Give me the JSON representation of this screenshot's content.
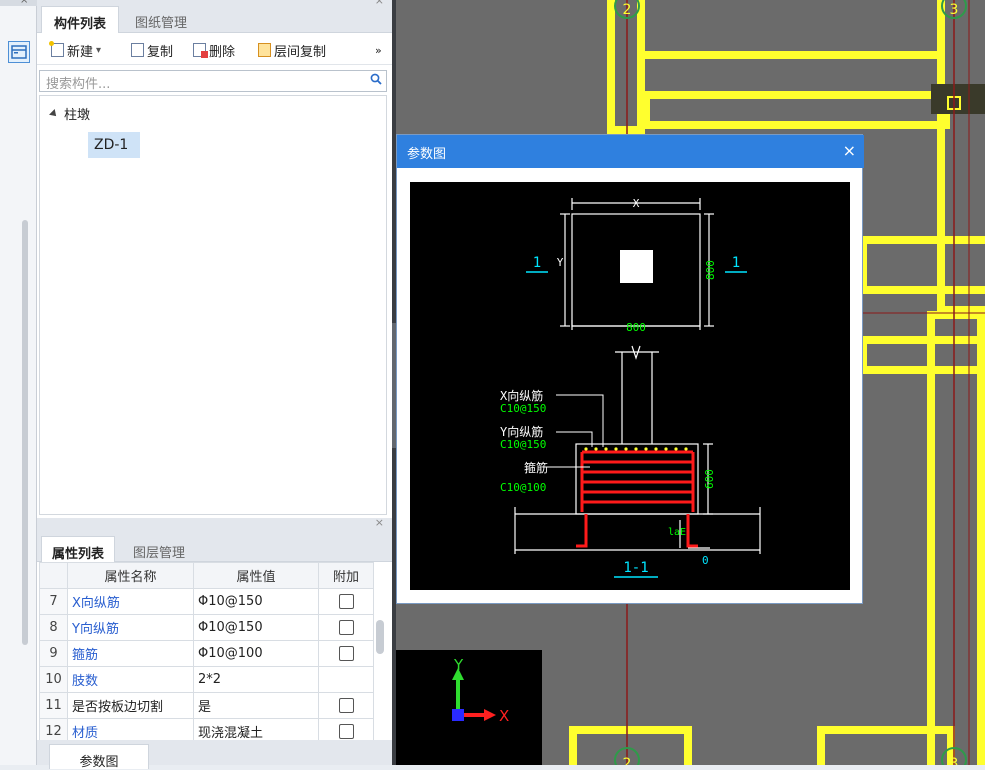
{
  "left_strip": {
    "close_label": "×",
    "button_icon": "window-icon"
  },
  "component_panel": {
    "tabs": [
      "构件列表",
      "图纸管理"
    ],
    "close_label": "×",
    "toolbar": {
      "new": "新建",
      "dropdown": "▾",
      "copy": "复制",
      "delete": "删除",
      "floor_copy": "层间复制",
      "more": "»"
    },
    "search": {
      "placeholder": "搜索构件..."
    },
    "tree": {
      "root": "柱墩",
      "children": [
        "ZD-1"
      ]
    }
  },
  "property_panel": {
    "tabs": [
      "属性列表",
      "图层管理"
    ],
    "close_label": "×",
    "columns": [
      "属性名称",
      "属性值",
      "附加"
    ],
    "rows": [
      {
        "num": "7",
        "name": "X向纵筋",
        "value": " 10@150",
        "blue": true,
        "checkbox": true
      },
      {
        "num": "8",
        "name": "Y向纵筋",
        "value": " 10@150",
        "blue": true,
        "checkbox": true
      },
      {
        "num": "9",
        "name": "箍筋",
        "value": " 10@100",
        "blue": true,
        "checkbox": true
      },
      {
        "num": "10",
        "name": "肢数",
        "value": "2*2",
        "blue": true,
        "checkbox": false
      },
      {
        "num": "11",
        "name": "是否按板边切割",
        "value": "是",
        "blue": false,
        "checkbox": true
      },
      {
        "num": "12",
        "name": "材质",
        "value": "现浇混凝土",
        "blue": true,
        "checkbox": true
      }
    ],
    "bottom_tab": "参数图"
  },
  "rebar_symbol": "Φ",
  "cad": {
    "axis_labels": {
      "top_a": "2",
      "top_b": "3",
      "bottom_a": "2",
      "bottom_b": "3"
    },
    "ucs": {
      "x": "X",
      "y": "Y"
    }
  },
  "dialog": {
    "title": "参数图",
    "close_label": "×",
    "drawing": {
      "plan_x": "X",
      "plan_y": "Y",
      "plan_width": "800",
      "plan_height": "800",
      "section_mark": "1",
      "label_x": "X向纵筋",
      "label_x_spec": "C10@150",
      "label_y": "Y向纵筋",
      "label_y_spec": "C10@150",
      "label_stirrup": "箍筋",
      "label_stirrup_spec": "C10@100",
      "height": "600",
      "lae": "laE",
      "zero": "0",
      "section_title": "1-1"
    }
  },
  "colors": {
    "cad_bg": "#000000",
    "gray_area": "#6b6b6b",
    "beam_yellow": "#ffff2e",
    "grid_red": "#8b1a1a",
    "cyan": "#00e5ff",
    "green": "#00ff00",
    "rebar_red": "#ff1a1a",
    "dialog_blue": "#2f80df"
  }
}
